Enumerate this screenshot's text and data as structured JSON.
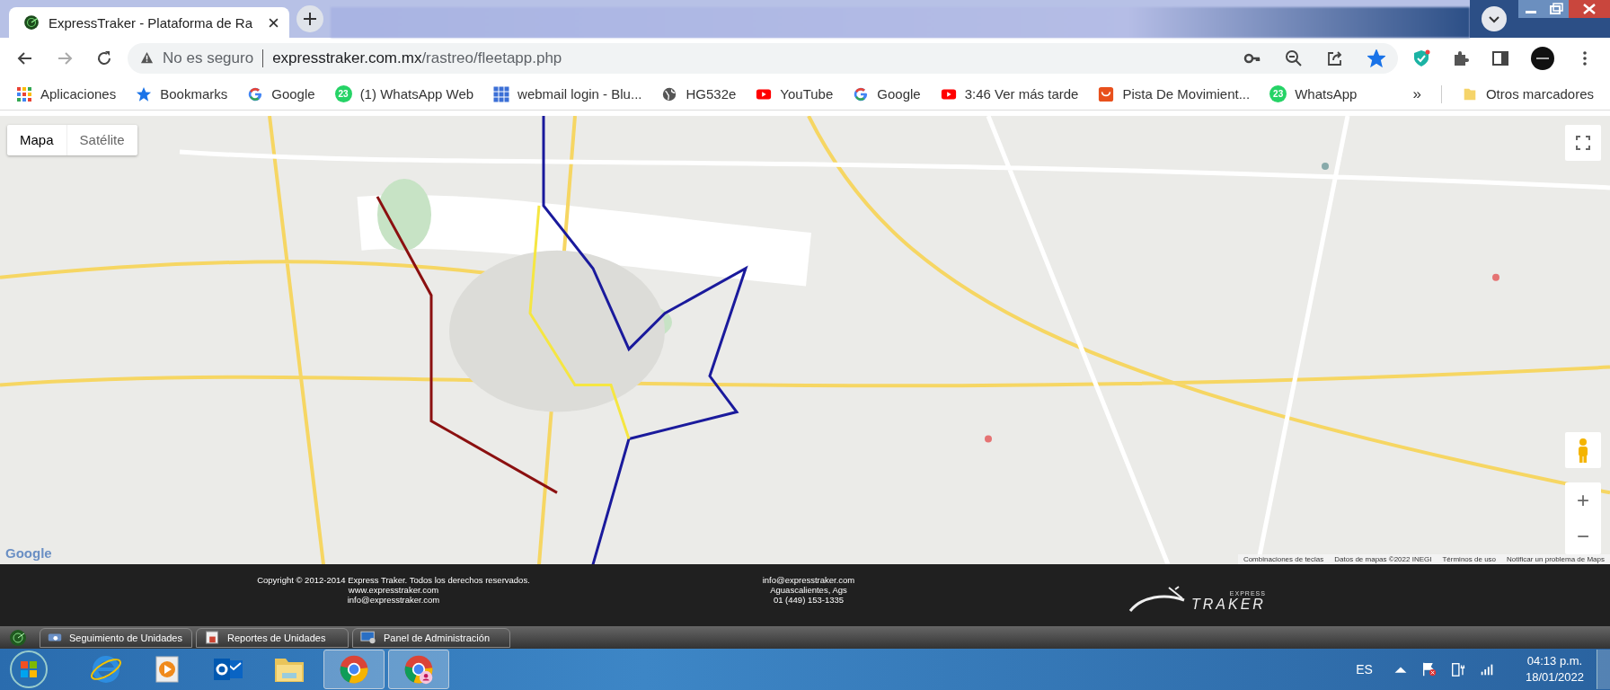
{
  "browser": {
    "active_tab": {
      "title": "ExpressTraker - Plataforma de Ra",
      "selected": true
    },
    "address": {
      "security": "No es seguro",
      "host": "expresstraker.com.mx",
      "path": "/rastreo/fleetapp.php",
      "bookmarked": true
    },
    "bookmarks": [
      {
        "label": "Aplicaciones"
      },
      {
        "label": "Bookmarks"
      },
      {
        "label": "Google"
      },
      {
        "label": "(1) WhatsApp Web",
        "badge": "23"
      },
      {
        "label": "webmail login - Blu..."
      },
      {
        "label": "HG532e"
      },
      {
        "label": "YouTube"
      },
      {
        "label": "Google"
      },
      {
        "label": "3:46 Ver más tarde"
      },
      {
        "label": "Pista De Movimient..."
      },
      {
        "label": "WhatsApp",
        "badge": "23"
      }
    ],
    "bookmarks_overflow": "»",
    "other_bookmarks": "Otros marcadores"
  },
  "map": {
    "type_toggle": [
      {
        "label": "Mapa",
        "selected": true
      },
      {
        "label": "Satélite",
        "selected": false
      }
    ],
    "logo": "Google",
    "zoom_in": "+",
    "zoom_out": "−",
    "attribution": [
      "Combinaciones de teclas",
      "Datos de mapas ©2022 INEGI",
      "Términos de uso",
      "Notificar un problema de Maps"
    ]
  },
  "footer": {
    "left": [
      "Copyright © 2012-2014 Express Traker. Todos los derechos reservados.",
      "www.expresstraker.com",
      "info@expresstraker.com"
    ],
    "center": [
      "info@expresstraker.com",
      "Aguascalientes, Ags",
      "01 (449) 153-1335"
    ],
    "logo_small": "EXPRESS",
    "logo_big": "TRAKER"
  },
  "app_tabs": [
    {
      "label": "Seguimiento de Unidades"
    },
    {
      "label": "Reportes de Unidades"
    },
    {
      "label": "Panel de Administración"
    }
  ],
  "taskbar": {
    "language": "ES",
    "time": "04:13 p.m.",
    "date": "18/01/2022"
  }
}
